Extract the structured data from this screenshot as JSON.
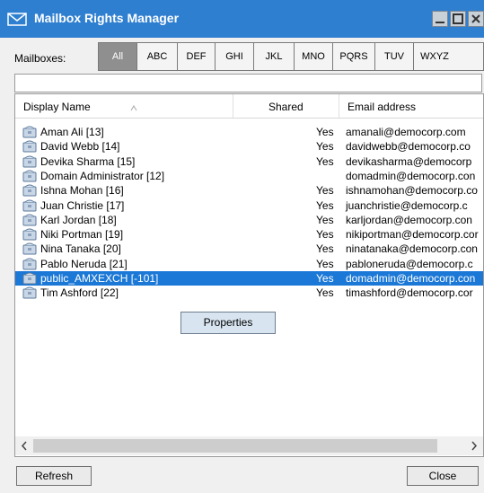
{
  "window": {
    "title": "Mailbox Rights Manager",
    "app_icon": "envelope-icon",
    "title_color": "#2f7fd0"
  },
  "filters": {
    "label": "Mailboxes:",
    "tabs": [
      "All",
      "ABC",
      "DEF",
      "GHI",
      "JKL",
      "MNO",
      "PQRS",
      "TUV",
      "WXYZ"
    ],
    "active": "All"
  },
  "search": {
    "value": ""
  },
  "table": {
    "columns": {
      "display_name": "Display Name",
      "shared": "Shared",
      "email": "Email address"
    },
    "rows": [
      {
        "name": "Aman Ali [13]",
        "shared": "Yes",
        "email": "amanali@democorp.com"
      },
      {
        "name": "David Webb [14]",
        "shared": "Yes",
        "email": "davidwebb@democorp.co"
      },
      {
        "name": "Devika Sharma [15]",
        "shared": "Yes",
        "email": "devikasharma@democorp"
      },
      {
        "name": "Domain Administrator [12]",
        "shared": "",
        "email": "domadmin@democorp.con"
      },
      {
        "name": "Ishna Mohan [16]",
        "shared": "Yes",
        "email": "ishnamohan@democorp.co"
      },
      {
        "name": "Juan Christie [17]",
        "shared": "Yes",
        "email": "juanchristie@democorp.c"
      },
      {
        "name": "Karl Jordan [18]",
        "shared": "Yes",
        "email": "karljordan@democorp.con"
      },
      {
        "name": "Niki Portman [19]",
        "shared": "Yes",
        "email": "nikiportman@democorp.cor"
      },
      {
        "name": "Nina Tanaka [20]",
        "shared": "Yes",
        "email": "ninatanaka@democorp.con"
      },
      {
        "name": "Pablo Neruda [21]",
        "shared": "Yes",
        "email": "pabloneruda@democorp.c"
      },
      {
        "name": "public_AMXEXCH [-101]",
        "shared": "Yes",
        "email": "domadmin@democorp.con"
      },
      {
        "name": "Tim Ashford [22]",
        "shared": "Yes",
        "email": "timashford@democorp.cor"
      }
    ],
    "selected_row": "public_AMXEXCH [-101]"
  },
  "context_menu": {
    "item": "Properties"
  },
  "buttons": {
    "refresh": "Refresh",
    "close": "Close"
  },
  "colors": {
    "selection": "#1b78d6",
    "active_filter": "#8f8f8f"
  }
}
